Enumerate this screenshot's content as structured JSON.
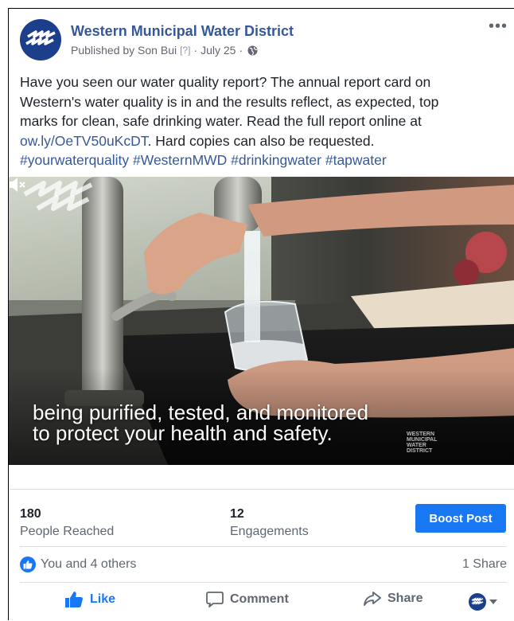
{
  "post": {
    "page_name": "Western Municipal Water District",
    "published_by": "Published by Son Bui",
    "help_marker": "[?]",
    "date_sep": "·",
    "date": "July 25",
    "text_line1": "Have you seen our water quality report? The annual report card on",
    "text_line2": "Western's water quality is in and the results reflect, as expected, top",
    "text_line3": "marks for clean, safe drinking water. Read the full report online at",
    "link": "ow.ly/OeTV50uKcDT",
    "text_after_link": ". Hard copies can also be requested.",
    "hashtags": "#yourwaterquality #WesternMWD #drinkingwater #tapwater"
  },
  "video": {
    "caption_line1": "being purified, tested, and monitored",
    "caption_line2": "to protect your health and safety.",
    "watermark_line1": "WESTERN",
    "watermark_line2": "MUNICIPAL",
    "watermark_line3": "WATER",
    "watermark_line4": "DISTRICT"
  },
  "stats": {
    "reached_value": "180",
    "reached_label": "People Reached",
    "engagements_value": "12",
    "engagements_label": "Engagements",
    "boost_label": "Boost Post"
  },
  "reactions": {
    "likes_text": "You and 4 others",
    "shares_text": "1 Share"
  },
  "actions": {
    "like": "Like",
    "comment": "Comment",
    "share": "Share"
  },
  "colors": {
    "link": "#365899",
    "boost_bg": "#1877f2",
    "like_blue": "#1877f2",
    "avatar_navy": "#1c3f8c"
  },
  "icons": [
    "more-options-icon",
    "globe-icon",
    "mute-icon",
    "like-icon",
    "comment-icon",
    "share-icon",
    "chevron-down-icon"
  ]
}
